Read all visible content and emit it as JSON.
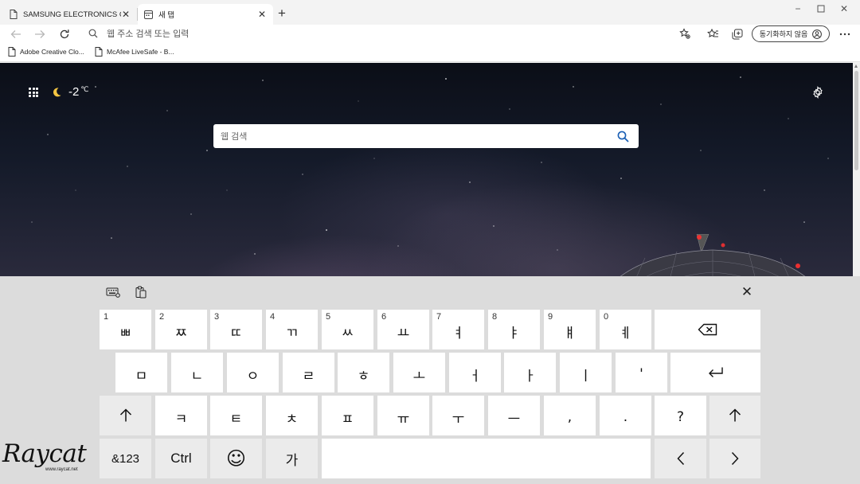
{
  "browser": {
    "tabs": [
      {
        "title": "SAMSUNG ELECTRONICS CO., LTD",
        "active": false
      },
      {
        "title": "새 탭",
        "active": true
      }
    ],
    "address_placeholder": "웹 주소 검색 또는 입력",
    "sync_label": "동기화하지 않음",
    "favorites": [
      {
        "label": "Adobe Creative Clo..."
      },
      {
        "label": "McAfee LiveSafe - B..."
      }
    ]
  },
  "newtab": {
    "weather_temp": "-2",
    "weather_unit": "℃",
    "search_placeholder": "웹 검색"
  },
  "keyboard": {
    "row1": [
      {
        "num": "1",
        "label": "ㅃ"
      },
      {
        "num": "2",
        "label": "ㅉ"
      },
      {
        "num": "3",
        "label": "ㄸ"
      },
      {
        "num": "4",
        "label": "ㄲ"
      },
      {
        "num": "5",
        "label": "ㅆ"
      },
      {
        "num": "6",
        "label": "ㅛ"
      },
      {
        "num": "7",
        "label": "ㅕ"
      },
      {
        "num": "8",
        "label": "ㅑ"
      },
      {
        "num": "9",
        "label": "ㅒ"
      },
      {
        "num": "0",
        "label": "ㅖ"
      }
    ],
    "row2": [
      "ㅁ",
      "ㄴ",
      "ㅇ",
      "ㄹ",
      "ㅎ",
      "ㅗ",
      "ㅓ",
      "ㅏ",
      "ㅣ",
      "'"
    ],
    "row3": [
      "ㅋ",
      "ㅌ",
      "ㅊ",
      "ㅍ",
      "ㅠ",
      "ㅜ",
      "ㅡ",
      ",",
      ".",
      "?"
    ],
    "symbols_label": "&123",
    "ctrl_label": "Ctrl",
    "emoji_label": "☺",
    "lang_label": "가",
    "icons": {
      "backspace": "backspace-icon",
      "enter": "enter-icon",
      "shift": "shift-icon",
      "left": "arrow-left-icon",
      "right": "arrow-right-icon",
      "settings": "keyboard-settings-icon",
      "clipboard": "clipboard-icon",
      "close": "close-icon"
    }
  },
  "watermark": {
    "logo": "Raycat",
    "url": "www.raycat.net"
  }
}
